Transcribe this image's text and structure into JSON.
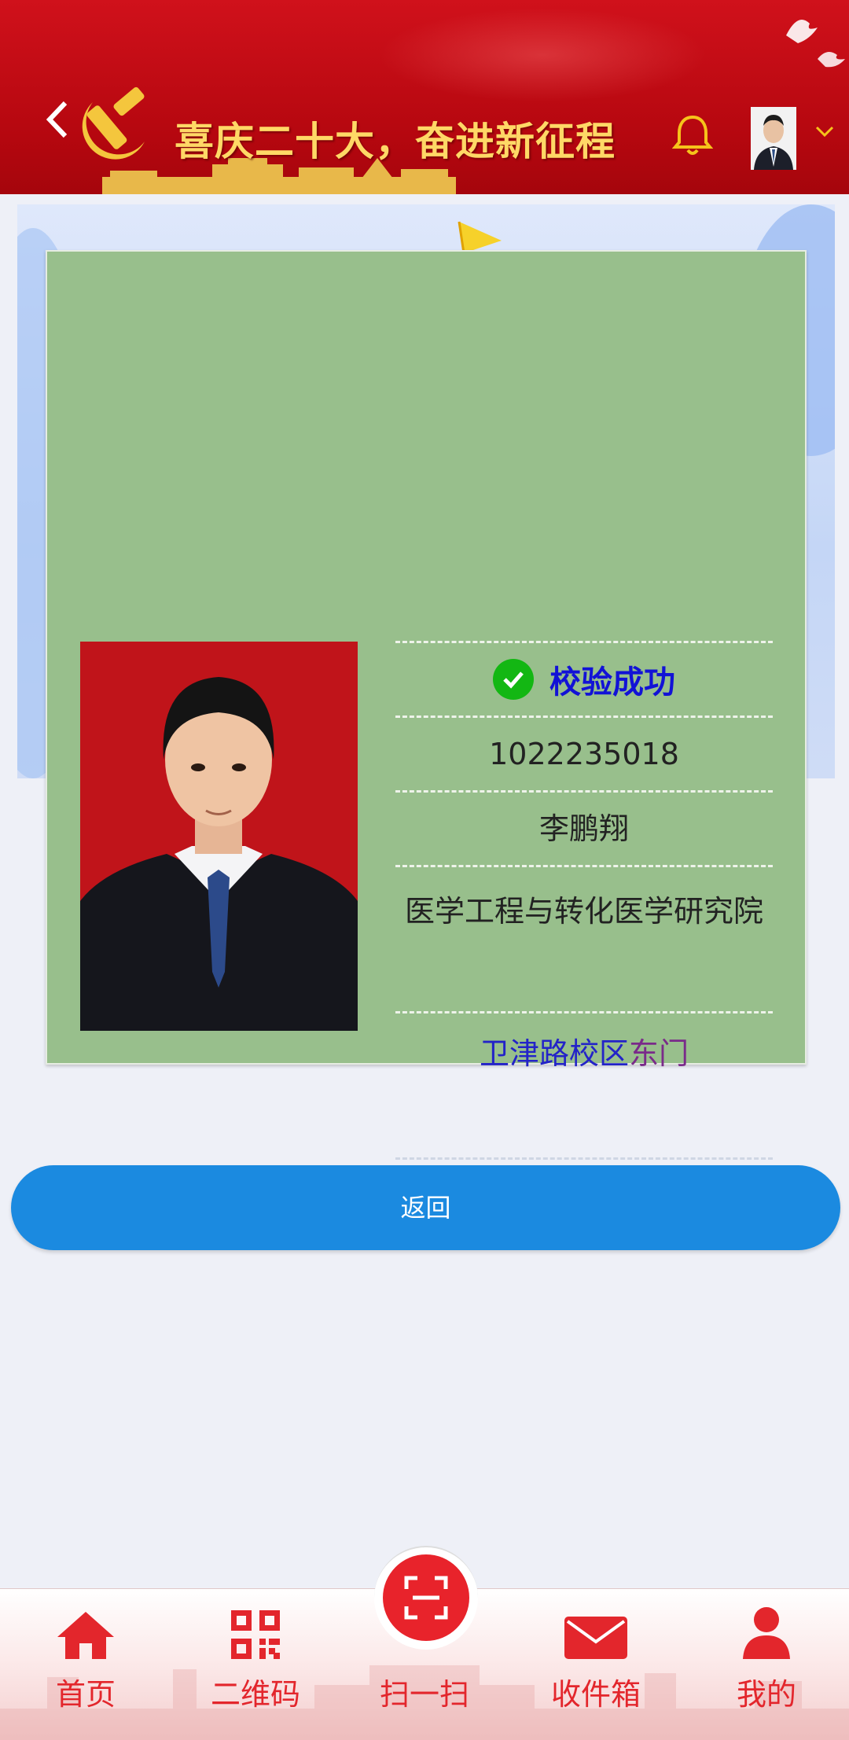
{
  "header": {
    "title": "喜庆二十大，奋进新征程",
    "icons": [
      "back-icon",
      "party-emblem-icon",
      "bell-icon",
      "avatar",
      "chevron-down-icon"
    ],
    "brand_color": "#c8101a",
    "title_color": "#ffd866"
  },
  "verification": {
    "status": "校验成功",
    "status_icon": "check-circle-icon",
    "status_color": "#1212d6",
    "id_number": "1022235018",
    "name": "李鹏翔",
    "department": "医学工程与转化医学研究院",
    "gate_campus": "卫津路校区",
    "gate_door": "东门",
    "panel_color": "#98bf8c"
  },
  "actions": {
    "return_label": "返回",
    "button_color": "#1b8ae0"
  },
  "bottom_nav": {
    "items": [
      {
        "label": "首页",
        "icon": "home-icon"
      },
      {
        "label": "二维码",
        "icon": "qr-code-icon"
      },
      {
        "label": "扫一扫",
        "icon": "scan-icon"
      },
      {
        "label": "收件箱",
        "icon": "mail-icon"
      },
      {
        "label": "我的",
        "icon": "user-icon"
      }
    ],
    "accent_color": "#e3262c"
  }
}
